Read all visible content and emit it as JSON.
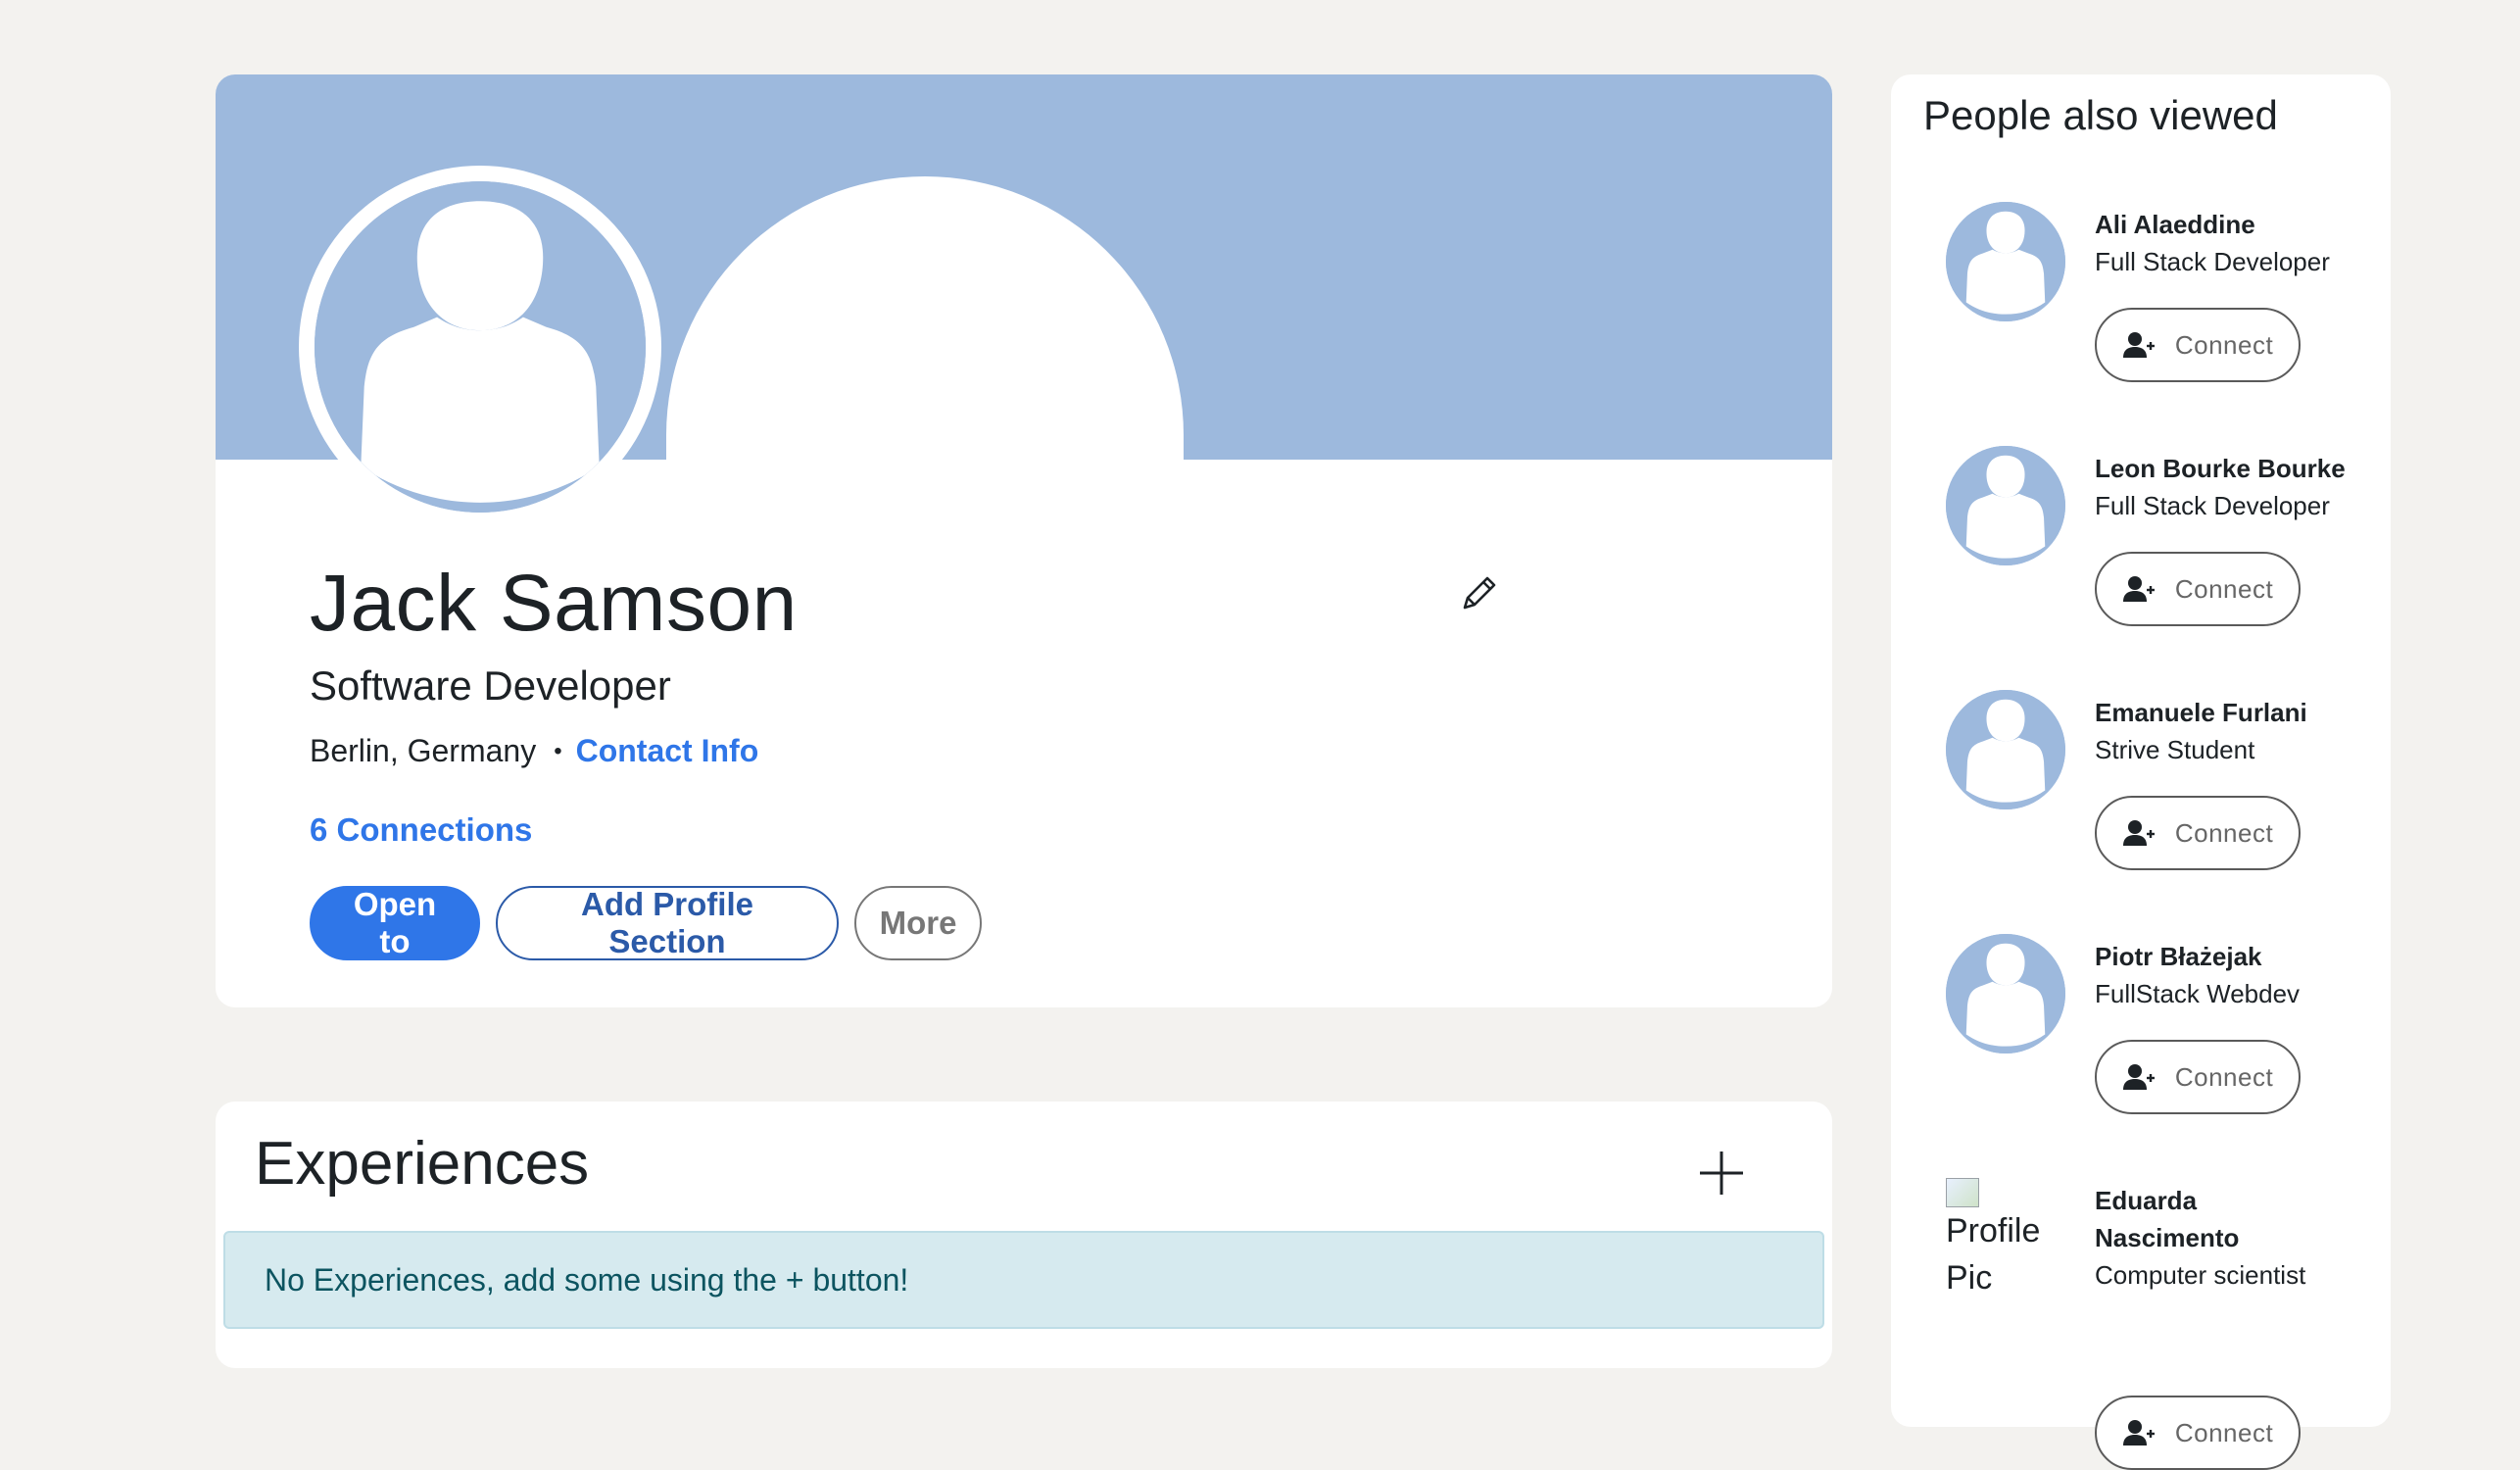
{
  "profile": {
    "name": "Jack Samson",
    "headline": "Software Developer",
    "location": "Berlin, Germany",
    "separator": "•",
    "contact_info_label": "Contact Info",
    "connections_label": "6 Connections",
    "buttons": {
      "open_to": "Open to",
      "add_profile_section": "Add Profile Section",
      "more": "More"
    },
    "icons": {
      "edit": "pencil-icon",
      "avatar": "default-avatar-icon"
    }
  },
  "experiences": {
    "title": "Experiences",
    "add_icon": "plus-icon",
    "empty_message": "No Experiences, add some using the + button!"
  },
  "sidebar": {
    "title": "People also viewed",
    "people": [
      {
        "name": "Ali Alaeddine",
        "role": "Full Stack Developer",
        "connect_label": "Connect"
      },
      {
        "name": "Leon Bourke Bourke",
        "role": "Full Stack Developer",
        "connect_label": "Connect"
      },
      {
        "name": "Emanuele Furlani",
        "role": "Strive Student",
        "connect_label": "Connect"
      },
      {
        "name": "Piotr Błażejak",
        "role": "FullStack Webdev",
        "connect_label": "Connect"
      },
      {
        "name_line1": "Eduarda",
        "name_line2": "Nascimento",
        "role": "Computer scientist",
        "connect_label": "Connect",
        "image_alt_line1": "Profile",
        "image_alt_line2": "Pic"
      }
    ]
  },
  "colors": {
    "page_background": "#f3f2ef",
    "banner": "#9db9dd",
    "primary": "#2f76e8",
    "outline_button": "#2b5aa8",
    "alert_background": "#d6eaef",
    "alert_text": "#0c5460"
  }
}
